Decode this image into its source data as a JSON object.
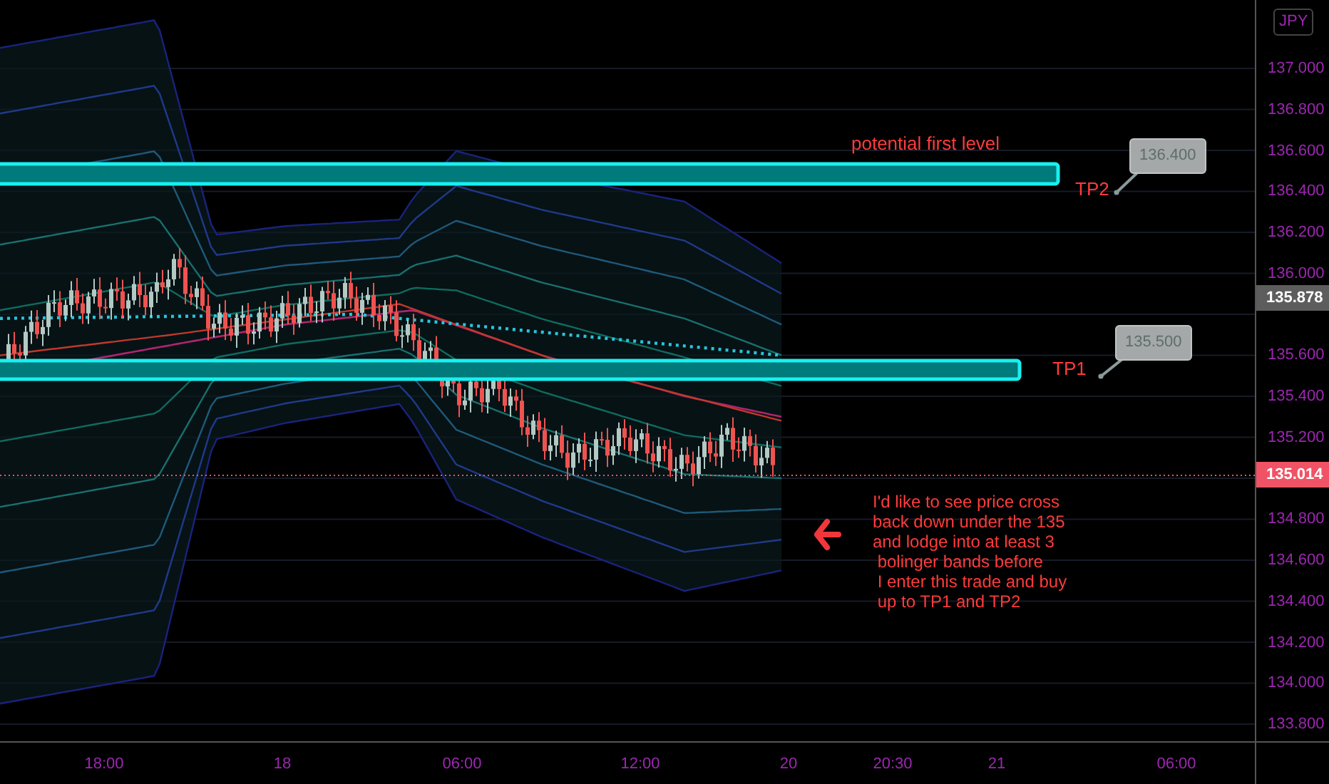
{
  "price_axis": {
    "currency": "JPY",
    "ticks": [
      "137.000",
      "136.800",
      "136.600",
      "136.400",
      "136.200",
      "136.000",
      "135.600",
      "135.400",
      "135.200",
      "134.800",
      "134.600",
      "134.400",
      "134.200",
      "134.000",
      "133.800"
    ],
    "price_labels": [
      {
        "kind": "last",
        "text": "135.878"
      },
      {
        "kind": "current",
        "text": "135.014"
      }
    ]
  },
  "time_axis": {
    "ticks": [
      "18:00",
      "18",
      "06:00",
      "12:00",
      "20",
      "20:30",
      "21",
      "06:00"
    ]
  },
  "annotations": {
    "top_note": "potential first level",
    "targets": [
      {
        "label": "TP2",
        "callout": "136.400"
      },
      {
        "label": "TP1",
        "callout": "135.500"
      }
    ],
    "comment_lines": [
      "I'd like to see price cross",
      "back down under the 135",
      "and lodge into at least 3",
      " bolinger bands before",
      " I enter this trade and buy",
      " up to TP1 and TP2"
    ]
  }
}
